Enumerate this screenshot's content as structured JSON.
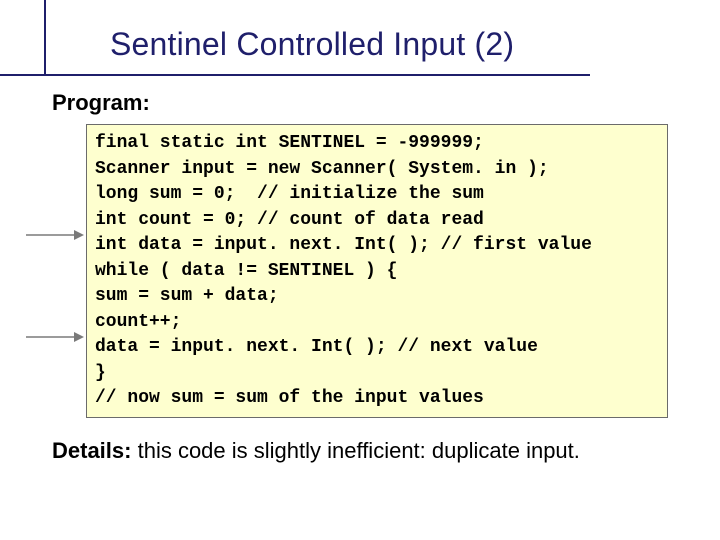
{
  "title": "Sentinel Controlled Input (2)",
  "label_program": "Program:",
  "code_lines": [
    "final static int SENTINEL = -999999;",
    "Scanner input = new Scanner( System. in );",
    "long sum = 0;  // initialize the sum",
    "int count = 0; // count of data read",
    "int data = input. next. Int( ); // first value",
    "while ( data != SENTINEL ) {",
    "sum = sum + data;",
    "count++;",
    "data = input. next. Int( ); // next value",
    "}",
    "// now sum = sum of the input values"
  ],
  "details_label": "Details:",
  "details_text": "  this code is slightly inefficient: duplicate input.",
  "arrow_targets": [
    5,
    9
  ]
}
